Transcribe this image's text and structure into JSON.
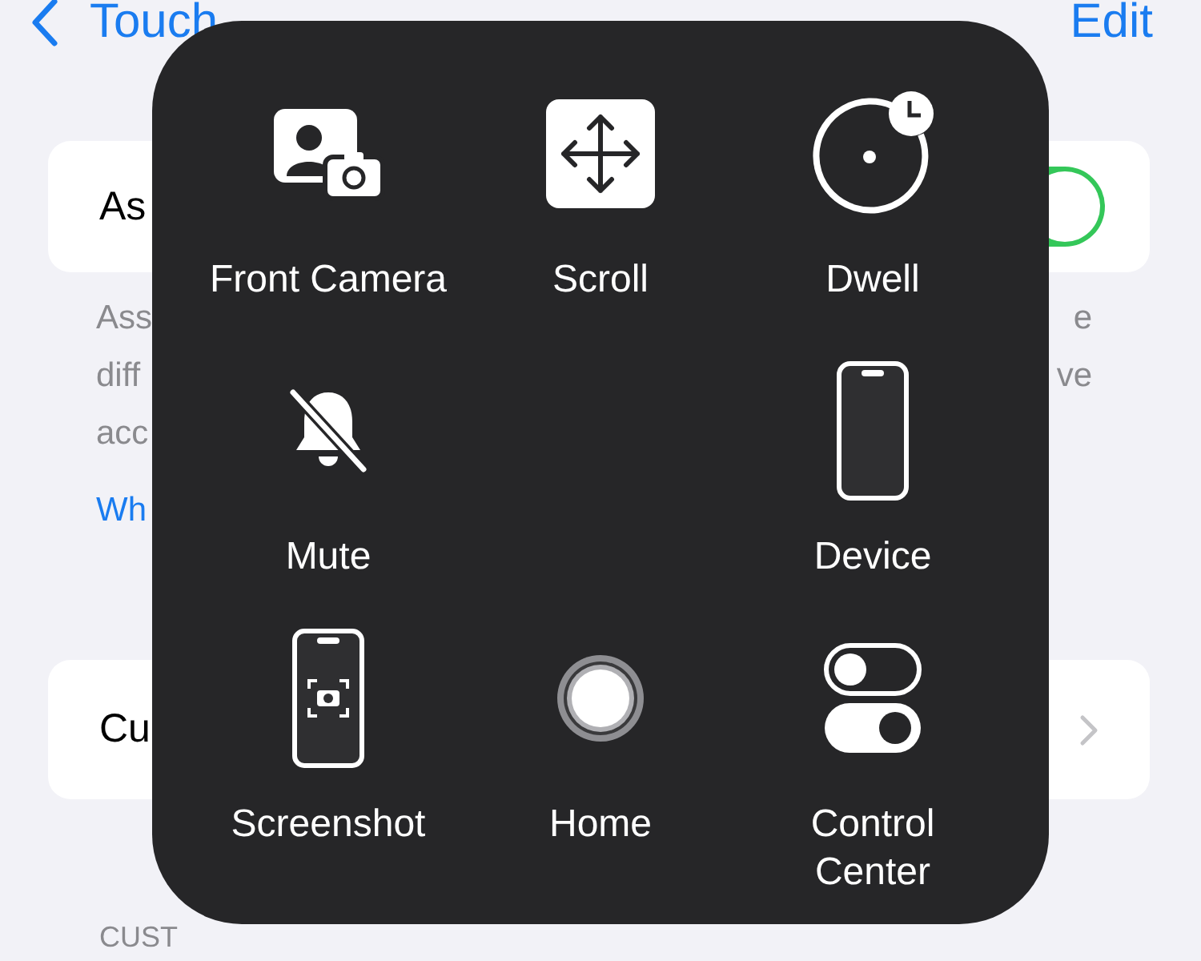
{
  "nav": {
    "back": "Touch",
    "action": "Edit"
  },
  "main_row": {
    "label": "As",
    "on": true
  },
  "footer_left": [
    "Ass",
    "diff",
    "acc"
  ],
  "footer_right": [
    "e",
    "ve"
  ],
  "link": "Wh",
  "customize_row": {
    "label": "Cu"
  },
  "section_header": "CUST",
  "menu": {
    "rows": [
      [
        {
          "kind": "front-camera",
          "label": "Front Camera"
        },
        {
          "kind": "scroll",
          "label": "Scroll"
        },
        {
          "kind": "dwell",
          "label": "Dwell"
        }
      ],
      [
        {
          "kind": "mute",
          "label": "Mute"
        },
        null,
        {
          "kind": "device",
          "label": "Device"
        }
      ],
      [
        {
          "kind": "screenshot",
          "label": "Screenshot"
        },
        {
          "kind": "home",
          "label": "Home"
        },
        {
          "kind": "control-center",
          "label": "Control Center"
        }
      ]
    ]
  }
}
